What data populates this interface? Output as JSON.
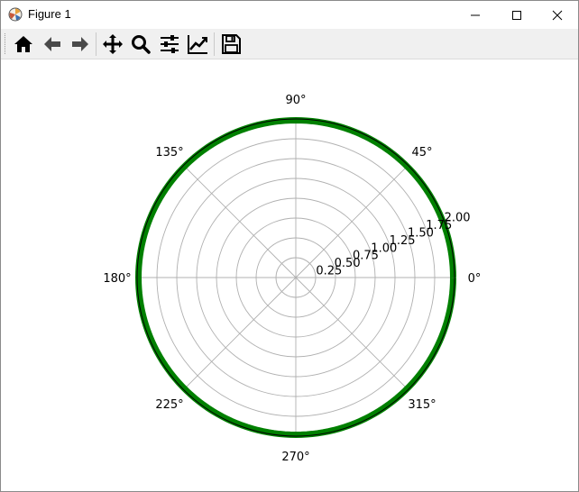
{
  "window": {
    "title": "Figure 1",
    "minimize_icon": "minimize-icon",
    "maximize_icon": "maximize-icon",
    "close_icon": "close-icon"
  },
  "toolbar": {
    "items": [
      {
        "name": "home-button",
        "icon": "home-icon",
        "tooltip": "Reset original view"
      },
      {
        "name": "back-button",
        "icon": "arrow-left-icon",
        "tooltip": "Back to previous view"
      },
      {
        "name": "forward-button",
        "icon": "arrow-right-icon",
        "tooltip": "Forward to next view"
      },
      {
        "name": "pan-button",
        "icon": "move-icon",
        "tooltip": "Pan axes"
      },
      {
        "name": "zoom-button",
        "icon": "magnifier-icon",
        "tooltip": "Zoom to rectangle"
      },
      {
        "name": "subplots-button",
        "icon": "sliders-icon",
        "tooltip": "Configure subplots"
      },
      {
        "name": "edit-axes-button",
        "icon": "chart-line-icon",
        "tooltip": "Edit axis parameters"
      },
      {
        "name": "save-button",
        "icon": "floppy-disk-icon",
        "tooltip": "Save the figure"
      }
    ]
  },
  "chart_data": {
    "type": "line",
    "projection": "polar",
    "theta_ticks": [
      "0°",
      "45°",
      "90°",
      "135°",
      "180°",
      "225°",
      "270°",
      "315°"
    ],
    "r_ticks": [
      "0.25",
      "0.50",
      "0.75",
      "1.00",
      "1.25",
      "1.50",
      "1.75",
      "2.00"
    ],
    "r_tick_values": [
      0.25,
      0.5,
      0.75,
      1.0,
      1.25,
      1.5,
      1.75,
      2.0
    ],
    "rlim": [
      0,
      2.0
    ],
    "grid": true,
    "series": [
      {
        "color": "#008000",
        "r": 2.0,
        "theta_range_deg": [
          0,
          360
        ]
      }
    ],
    "colors": {
      "grid": "#b0b0b0",
      "spine": "#000000",
      "series": "#008000"
    }
  }
}
